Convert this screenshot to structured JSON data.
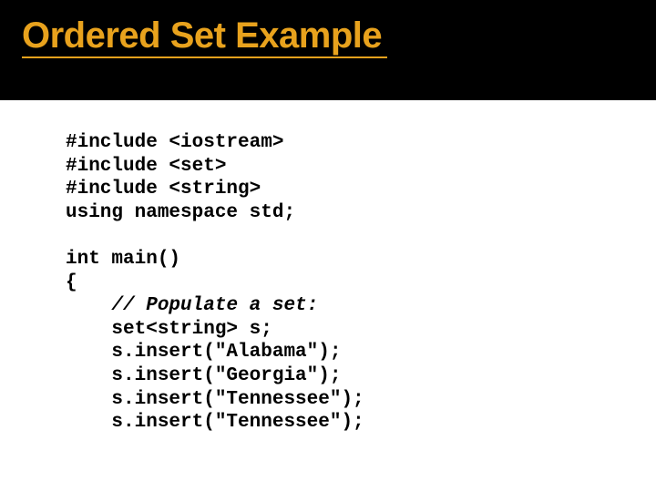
{
  "header": {
    "title": "Ordered Set Example"
  },
  "code": {
    "l1": "#include <iostream>",
    "l2": "#include <set>",
    "l3": "#include <string>",
    "l4": "using namespace std;",
    "l5": "",
    "l6": "int main()",
    "l7": "{",
    "l8_indent": "    ",
    "l8_comment": "// Populate a set:",
    "l9": "    set<string> s;",
    "l10": "    s.insert(\"Alabama\");",
    "l11": "    s.insert(\"Georgia\");",
    "l12": "    s.insert(\"Tennessee\");",
    "l13": "    s.insert(\"Tennessee\");"
  }
}
